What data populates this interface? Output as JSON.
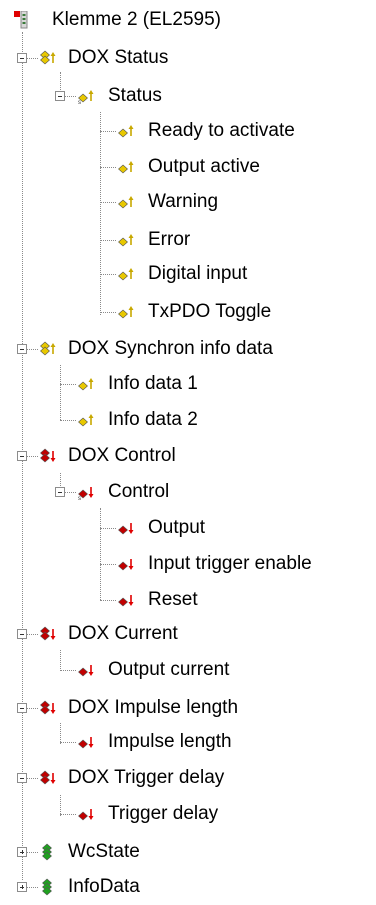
{
  "tree": {
    "root": {
      "label": "Klemme 2 (EL2595)",
      "icon": "terminal-icon"
    },
    "nodes": [
      {
        "id": "dox-status",
        "label": "DOX Status",
        "level": 1,
        "icon": "input-group-icon",
        "expanded": true
      },
      {
        "id": "status",
        "label": "Status",
        "level": 2,
        "icon": "input-struct-icon",
        "expanded": true
      },
      {
        "id": "ready-to-activate",
        "label": "Ready to activate",
        "level": 3,
        "icon": "input-var-icon"
      },
      {
        "id": "output-active",
        "label": "Output active",
        "level": 3,
        "icon": "input-var-icon"
      },
      {
        "id": "warning",
        "label": "Warning",
        "level": 3,
        "icon": "input-var-icon"
      },
      {
        "id": "error",
        "label": "Error",
        "level": 3,
        "icon": "input-var-icon"
      },
      {
        "id": "digital-input",
        "label": "Digital input",
        "level": 3,
        "icon": "input-var-icon"
      },
      {
        "id": "txpdo-toggle",
        "label": "TxPDO Toggle",
        "level": 3,
        "icon": "input-var-icon"
      },
      {
        "id": "dox-synchron-info-data",
        "label": "DOX Synchron info data",
        "level": 1,
        "icon": "input-group-icon",
        "expanded": true
      },
      {
        "id": "info-data-1",
        "label": "Info data 1",
        "level": 2,
        "icon": "input-var-icon"
      },
      {
        "id": "info-data-2",
        "label": "Info data 2",
        "level": 2,
        "icon": "input-var-icon"
      },
      {
        "id": "dox-control",
        "label": "DOX Control",
        "level": 1,
        "icon": "output-group-icon",
        "expanded": true
      },
      {
        "id": "control",
        "label": "Control",
        "level": 2,
        "icon": "output-struct-icon",
        "expanded": true
      },
      {
        "id": "output",
        "label": "Output",
        "level": 3,
        "icon": "output-var-icon"
      },
      {
        "id": "input-trigger-enable",
        "label": "Input trigger enable",
        "level": 3,
        "icon": "output-var-icon"
      },
      {
        "id": "reset",
        "label": "Reset",
        "level": 3,
        "icon": "output-var-icon"
      },
      {
        "id": "dox-current",
        "label": "DOX Current",
        "level": 1,
        "icon": "output-group-icon",
        "expanded": true
      },
      {
        "id": "output-current",
        "label": "Output current",
        "level": 2,
        "icon": "output-var-icon"
      },
      {
        "id": "dox-impulse-length",
        "label": "DOX Impulse length",
        "level": 1,
        "icon": "output-group-icon",
        "expanded": true
      },
      {
        "id": "impulse-length",
        "label": "Impulse length",
        "level": 2,
        "icon": "output-var-icon"
      },
      {
        "id": "dox-trigger-delay",
        "label": "DOX Trigger delay",
        "level": 1,
        "icon": "output-group-icon",
        "expanded": true
      },
      {
        "id": "trigger-delay",
        "label": "Trigger delay",
        "level": 2,
        "icon": "output-var-icon"
      },
      {
        "id": "wcstate",
        "label": "WcState",
        "level": 1,
        "icon": "status-group-icon",
        "expanded": false
      },
      {
        "id": "infodata",
        "label": "InfoData",
        "level": 1,
        "icon": "status-group-icon",
        "expanded": false
      }
    ]
  },
  "colors": {
    "input_arrow": "#c8a800",
    "input_diamond": "#e8c800",
    "output_arrow": "#e00000",
    "output_diamond": "#c00000",
    "status_diamond": "#20a020",
    "tree_line": "#8a8a8a"
  }
}
